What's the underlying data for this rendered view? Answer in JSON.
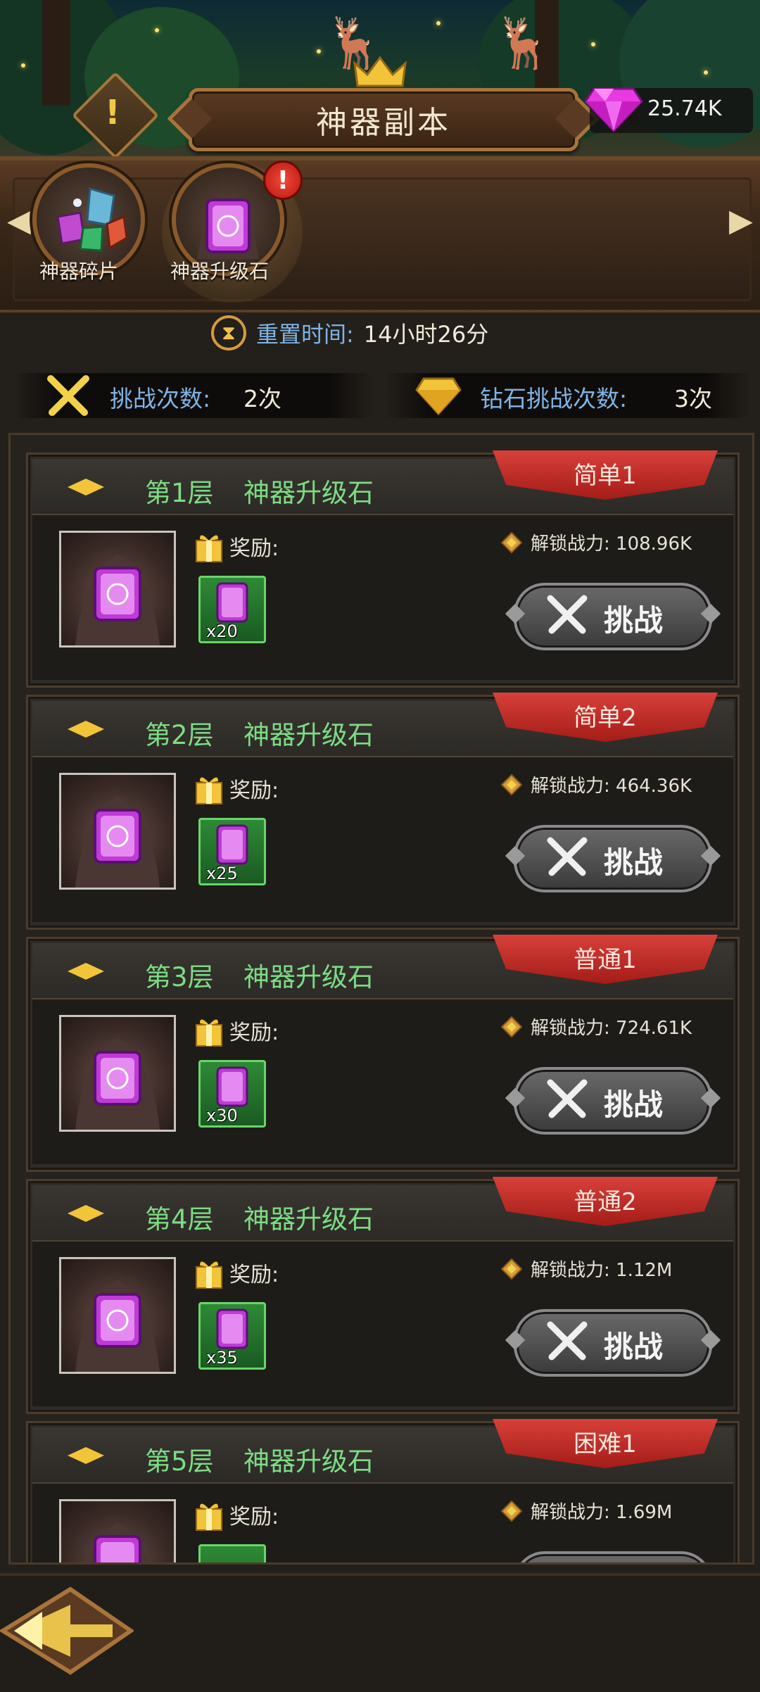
{
  "header": {
    "title": "神器副本",
    "gem_count": "25.74K"
  },
  "tabs": [
    {
      "label": "神器碎片",
      "icon": "artifact-shards-icon"
    },
    {
      "label": "神器升级石",
      "icon": "upgrade-stone-icon",
      "alert": "!"
    }
  ],
  "reset": {
    "label": "重置时间:",
    "value": "14小时26分"
  },
  "counts": {
    "challenge_label": "挑战次数:",
    "challenge_value": "2次",
    "diamond_label": "钻石挑战次数:",
    "diamond_value": "3次"
  },
  "floors": [
    {
      "floor": "第1层",
      "name": "神器升级石",
      "difficulty": "简单1",
      "reward_label": "奖励:",
      "reward_qty": "x20",
      "unlock": "解锁战力: 108.96K",
      "button": "挑战"
    },
    {
      "floor": "第2层",
      "name": "神器升级石",
      "difficulty": "简单2",
      "reward_label": "奖励:",
      "reward_qty": "x25",
      "unlock": "解锁战力: 464.36K",
      "button": "挑战"
    },
    {
      "floor": "第3层",
      "name": "神器升级石",
      "difficulty": "普通1",
      "reward_label": "奖励:",
      "reward_qty": "x30",
      "unlock": "解锁战力: 724.61K",
      "button": "挑战"
    },
    {
      "floor": "第4层",
      "name": "神器升级石",
      "difficulty": "普通2",
      "reward_label": "奖励:",
      "reward_qty": "x35",
      "unlock": "解锁战力: 1.12M",
      "button": "挑战"
    },
    {
      "floor": "第5层",
      "name": "神器升级石",
      "difficulty": "困难1",
      "reward_label": "奖励:",
      "unlock": "解锁战力: 1.69M"
    }
  ],
  "colors": {
    "floor_text": "#7ddc84",
    "ribbon": "#c8302a",
    "label_blue": "#7fb4e6",
    "frame_bronze": "#a8743c"
  }
}
